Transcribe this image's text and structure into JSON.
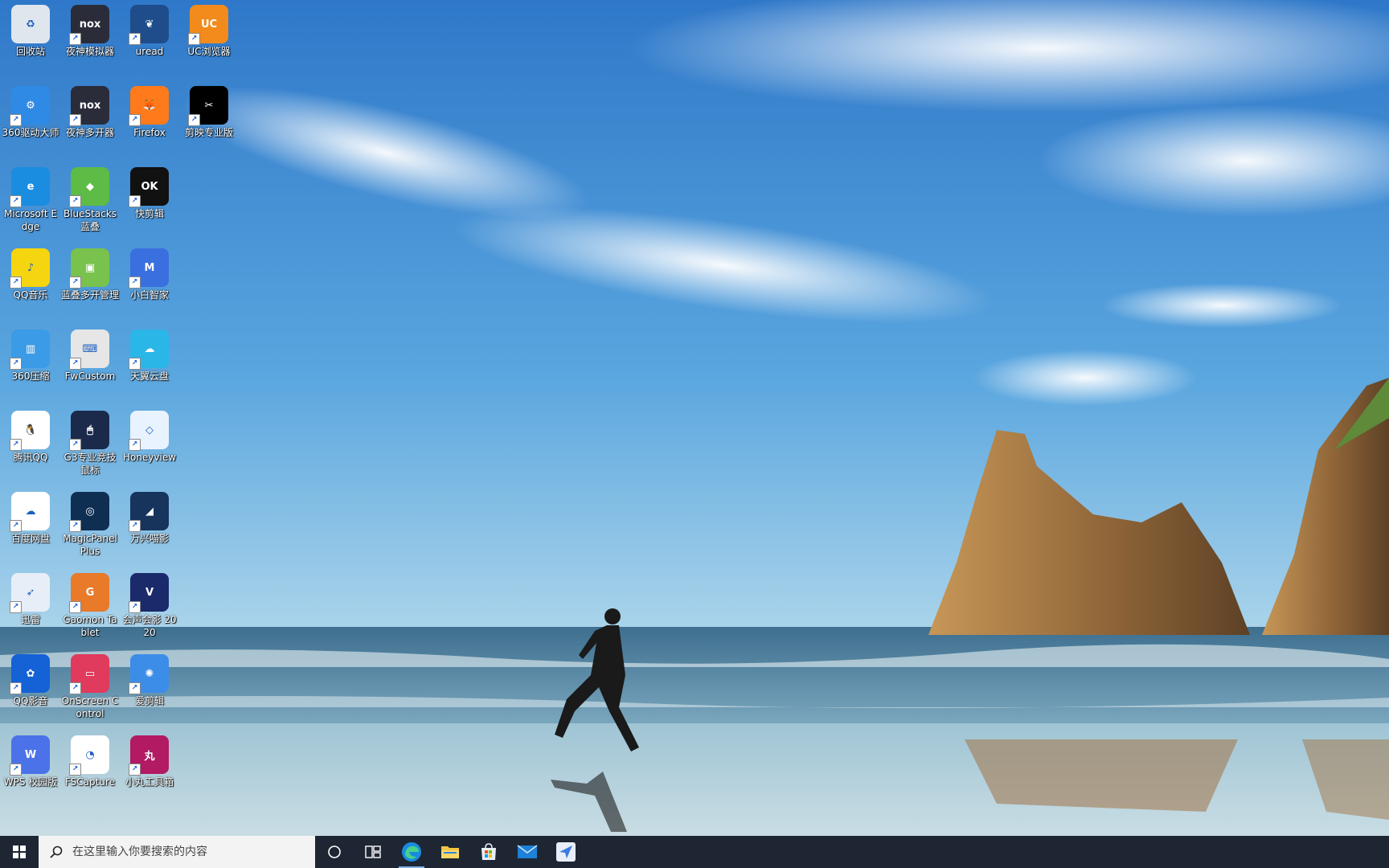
{
  "desktop": {
    "icons": [
      {
        "label": "回收站",
        "icon": "recycle-bin-icon",
        "shortcut": false,
        "color": "#dfe6ee",
        "glyph": "♻"
      },
      {
        "label": "360驱动大师",
        "icon": "360-driver-icon",
        "shortcut": true,
        "color": "#2f8ae6",
        "glyph": "⚙"
      },
      {
        "label": "Microsoft Edge",
        "icon": "edge-icon",
        "shortcut": true,
        "color": "#1a8de0",
        "glyph": "e"
      },
      {
        "label": "QQ音乐",
        "icon": "qq-music-icon",
        "shortcut": true,
        "color": "#f5d50f",
        "glyph": "♪"
      },
      {
        "label": "360压缩",
        "icon": "360-zip-icon",
        "shortcut": true,
        "color": "#3b9be6",
        "glyph": "▥"
      },
      {
        "label": "腾讯QQ",
        "icon": "qq-icon",
        "shortcut": true,
        "color": "#ffffff",
        "glyph": "🐧"
      },
      {
        "label": "百度网盘",
        "icon": "baidu-netdisk-icon",
        "shortcut": true,
        "color": "#ffffff",
        "glyph": "☁"
      },
      {
        "label": "迅雷",
        "icon": "xunlei-icon",
        "shortcut": true,
        "color": "#e8eef8",
        "glyph": "➶"
      },
      {
        "label": "QQ影音",
        "icon": "qq-player-icon",
        "shortcut": true,
        "color": "#1462d6",
        "glyph": "✿"
      },
      {
        "label": "WPS 校园版",
        "icon": "wps-icon",
        "shortcut": true,
        "color": "#4b72e8",
        "glyph": "W"
      },
      {
        "label": "夜神模拟器",
        "icon": "nox-player-icon",
        "shortcut": true,
        "color": "#2b2c3a",
        "glyph": "nox"
      },
      {
        "label": "夜神多开器",
        "icon": "nox-multi-icon",
        "shortcut": true,
        "color": "#2b2c3a",
        "glyph": "nox"
      },
      {
        "label": "BlueStacks 蓝叠",
        "icon": "bluestacks-icon",
        "shortcut": true,
        "color": "#5dbb46",
        "glyph": "◆"
      },
      {
        "label": "蓝叠多开管理",
        "icon": "bluestacks-multi-icon",
        "shortcut": true,
        "color": "#79c24d",
        "glyph": "▣"
      },
      {
        "label": "FwCustom",
        "icon": "keyboard-icon",
        "shortcut": true,
        "color": "#e6e6e6",
        "glyph": "⌨"
      },
      {
        "label": "G3专业竞技鼠标",
        "icon": "mouse-icon",
        "shortcut": true,
        "color": "#1b2a4a",
        "glyph": "🖱"
      },
      {
        "label": "MagicPanel Plus",
        "icon": "magicpanel-icon",
        "shortcut": true,
        "color": "#0e2f52",
        "glyph": "◎"
      },
      {
        "label": "Gaomon Tablet",
        "icon": "gaomon-icon",
        "shortcut": true,
        "color": "#e87a2a",
        "glyph": "G"
      },
      {
        "label": "OnScreen Control",
        "icon": "onscreen-control-icon",
        "shortcut": true,
        "color": "#e03a5c",
        "glyph": "▭"
      },
      {
        "label": "FSCapture",
        "icon": "fscapture-icon",
        "shortcut": true,
        "color": "#ffffff",
        "glyph": "◔"
      },
      {
        "label": "uread",
        "icon": "uread-icon",
        "shortcut": true,
        "color": "#1f4d8c",
        "glyph": "❦"
      },
      {
        "label": "Firefox",
        "icon": "firefox-icon",
        "shortcut": true,
        "color": "#ff7a1a",
        "glyph": "🦊"
      },
      {
        "label": "快剪辑",
        "icon": "kuaijianji-icon",
        "shortcut": true,
        "color": "#111111",
        "glyph": "OK"
      },
      {
        "label": "小白智家",
        "icon": "xiaobai-icon",
        "shortcut": true,
        "color": "#3a6fe0",
        "glyph": "M"
      },
      {
        "label": "天翼云盘",
        "icon": "tianyi-cloud-icon",
        "shortcut": true,
        "color": "#2bb6e8",
        "glyph": "☁"
      },
      {
        "label": "Honeyview",
        "icon": "honeyview-icon",
        "shortcut": true,
        "color": "#e8f3ff",
        "glyph": "◇"
      },
      {
        "label": "万兴喵影",
        "icon": "filmora-icon",
        "shortcut": true,
        "color": "#16345c",
        "glyph": "◢"
      },
      {
        "label": "会声会影 2020",
        "icon": "videostudio-icon",
        "shortcut": true,
        "color": "#1a2a6a",
        "glyph": "V"
      },
      {
        "label": "爱剪辑",
        "icon": "aijianji-icon",
        "shortcut": true,
        "color": "#3c8de8",
        "glyph": "✺"
      },
      {
        "label": "小丸工具箱",
        "icon": "xiaowan-icon",
        "shortcut": true,
        "color": "#b21a63",
        "glyph": "丸"
      },
      {
        "label": "UC浏览器",
        "icon": "uc-browser-icon",
        "shortcut": true,
        "color": "#f28a1c",
        "glyph": "UC"
      },
      {
        "label": "剪映专业版",
        "icon": "capcut-icon",
        "shortcut": true,
        "color": "#000000",
        "glyph": "✂"
      }
    ]
  },
  "taskbar": {
    "search_placeholder": "在这里输入你要搜索的内容",
    "pinned": [
      {
        "name": "edge",
        "icon": "edge-icon",
        "active": true
      },
      {
        "name": "file-explorer",
        "icon": "folder-icon",
        "active": false
      },
      {
        "name": "microsoft-store",
        "icon": "store-icon",
        "active": false
      },
      {
        "name": "mail",
        "icon": "mail-icon",
        "active": false
      },
      {
        "name": "xunlei",
        "icon": "xunlei-icon",
        "active": false
      }
    ]
  }
}
